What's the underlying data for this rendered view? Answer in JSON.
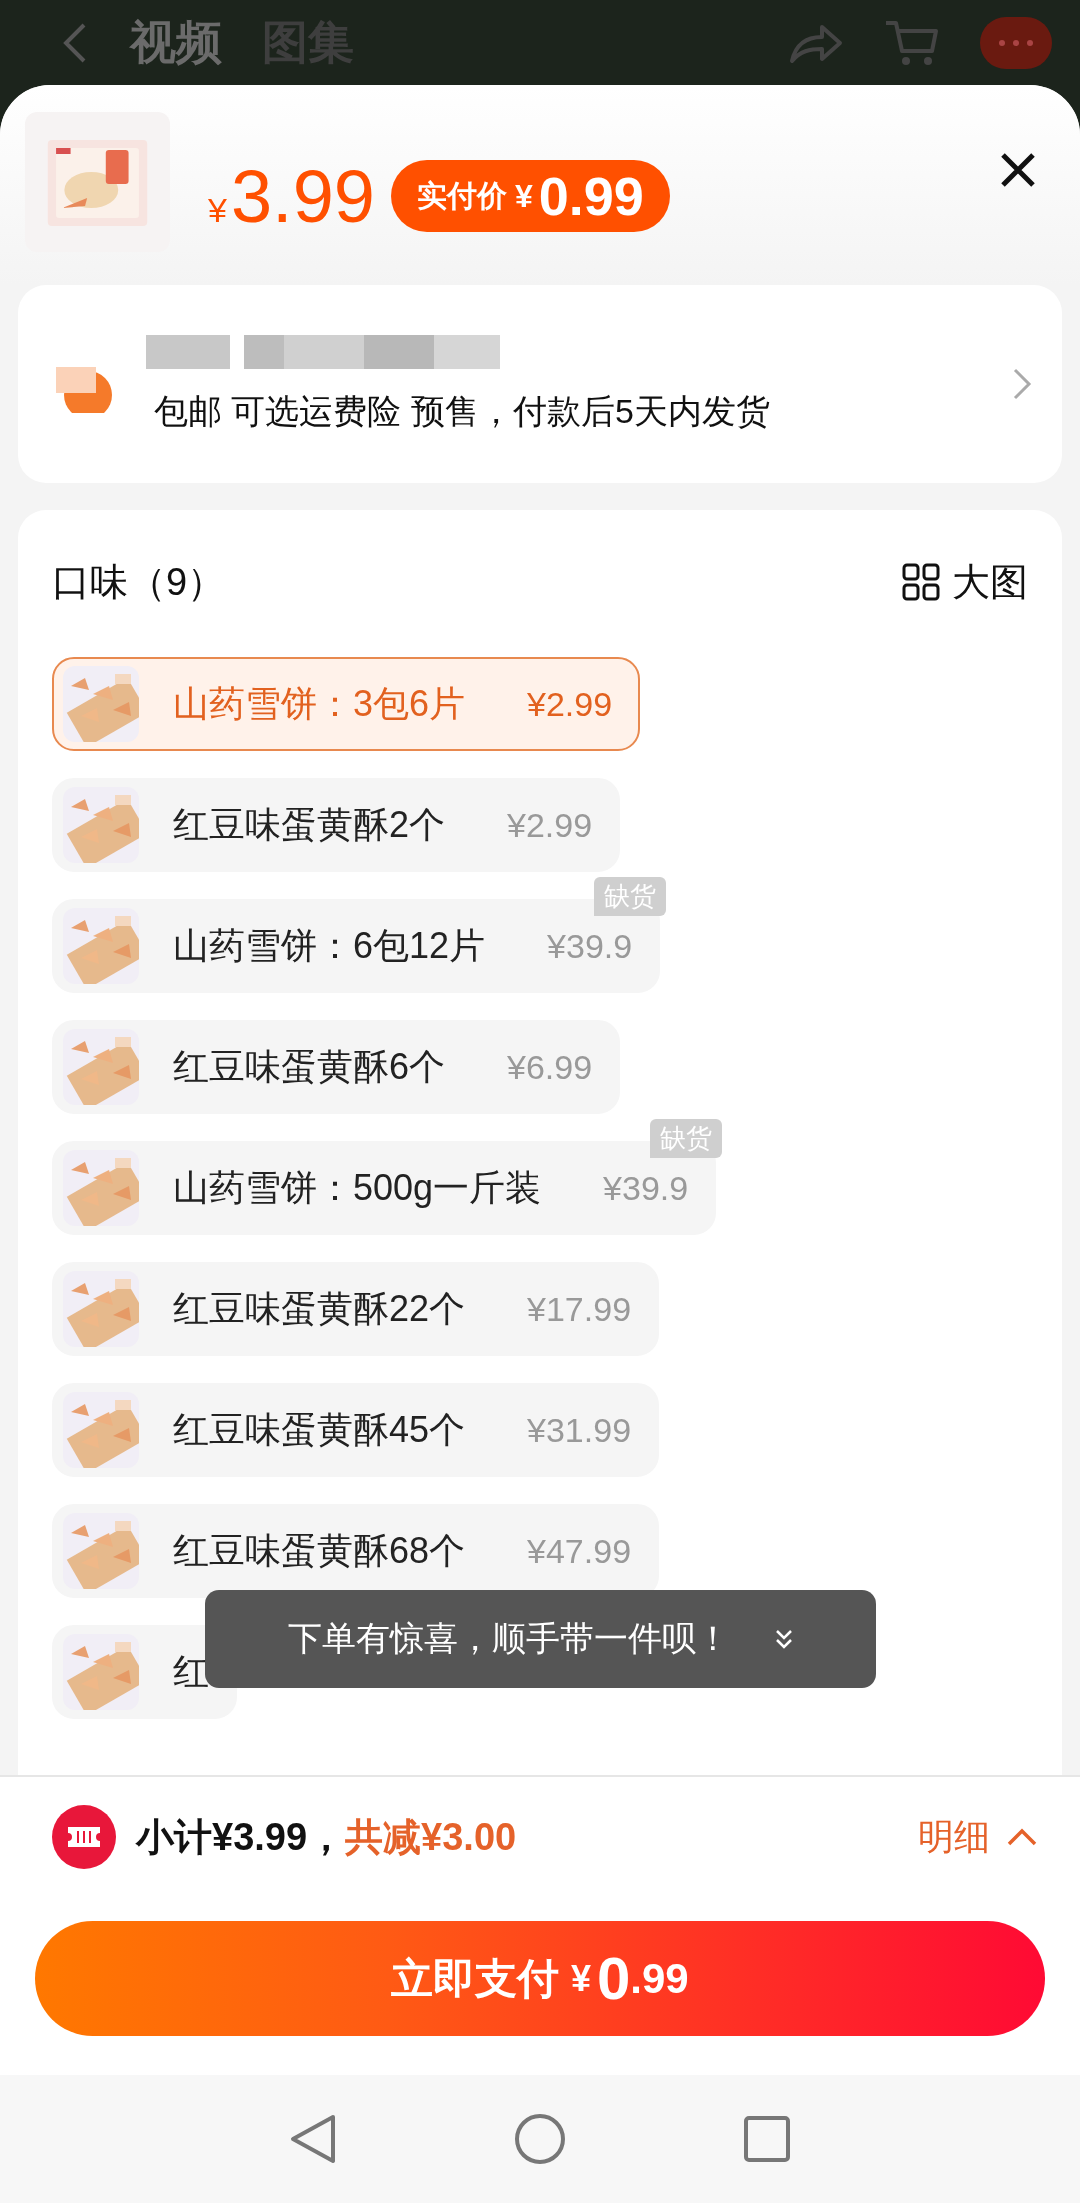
{
  "top_bar": {
    "tabs": [
      {
        "label": "视频",
        "selected": true
      },
      {
        "label": "图集",
        "selected": false
      }
    ]
  },
  "header": {
    "price": {
      "currency": "¥",
      "amount": "3.99"
    },
    "pay_badge": {
      "label": "实付价",
      "currency": "¥",
      "amount": "0.99"
    }
  },
  "delivery": {
    "text": "包邮 可选运费险 预售，付款后5天内发货"
  },
  "options": {
    "title": "口味（9）",
    "view_toggle": "大图",
    "items": [
      {
        "name": "山药雪饼：3包6片",
        "price": "¥2.99",
        "selected": true
      },
      {
        "name": "红豆味蛋黄酥2个",
        "price": "¥2.99",
        "selected": false
      },
      {
        "name": "山药雪饼：6包12片",
        "price": "¥39.9",
        "selected": false,
        "badge": "缺货"
      },
      {
        "name": "红豆味蛋黄酥6个",
        "price": "¥6.99",
        "selected": false
      },
      {
        "name": "山药雪饼：500g一斤装",
        "price": "¥39.9",
        "selected": false,
        "badge": "缺货"
      },
      {
        "name": "红豆味蛋黄酥22个",
        "price": "¥17.99",
        "selected": false
      },
      {
        "name": "红豆味蛋黄酥45个",
        "price": "¥31.99",
        "selected": false
      },
      {
        "name": "红豆味蛋黄酥68个",
        "price": "¥47.99",
        "selected": false
      },
      {
        "name": "红",
        "selected": false
      }
    ]
  },
  "toast": {
    "text": "下单有惊喜，顺手带一件呗！"
  },
  "summary": {
    "subtotal": "小计¥3.99，",
    "discount": "共减¥3.00",
    "details": "明细"
  },
  "pay_button": {
    "label": "立即支付",
    "currency": "¥",
    "integer": "0",
    "decimal": ".99"
  }
}
